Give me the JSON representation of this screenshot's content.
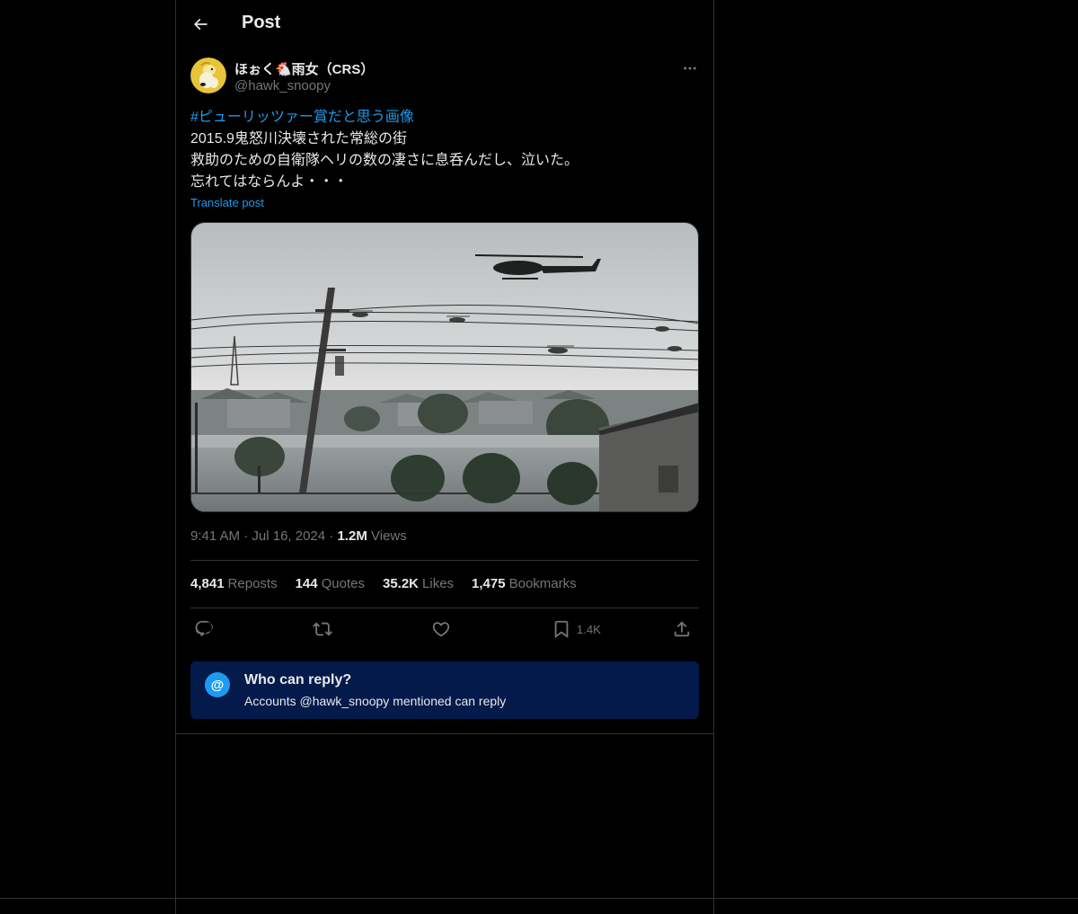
{
  "header": {
    "title": "Post",
    "back_icon": "arrow-left-icon"
  },
  "author": {
    "display_name": "ほぉく🐔雨女（CRS）",
    "handle": "@hawk_snoopy",
    "avatar_icon": "snoopy-avatar"
  },
  "tweet": {
    "hashtag": "#ピューリッツァー賞だと思う画像",
    "lines": [
      "2015.9鬼怒川決壊された常総の街",
      "救助のための自衛隊ヘリの数の凄さに息呑んだし、泣いた。",
      "忘れてはならんよ・・・"
    ],
    "translate_label": "Translate post"
  },
  "meta": {
    "time": "9:41 AM",
    "separator": "·",
    "date": "Jul 16, 2024",
    "views_count": "1.2M",
    "views_label": "Views"
  },
  "stats": {
    "reposts_count": "4,841",
    "reposts_label": "Reposts",
    "quotes_count": "144",
    "quotes_label": "Quotes",
    "likes_count": "35.2K",
    "likes_label": "Likes",
    "bookmarks_count": "1,475",
    "bookmarks_label": "Bookmarks"
  },
  "actions": {
    "bookmark_count": "1.4K"
  },
  "reply_restriction": {
    "title": "Who can reply?",
    "subtitle": "Accounts @hawk_snoopy mentioned can reply",
    "icon_glyph": "@"
  },
  "colors": {
    "background": "#000000",
    "accent": "#1d9bf0",
    "text": "#e7e9ea",
    "muted": "#71767b",
    "border": "#2f3336",
    "reply_box": "#031a4a"
  }
}
